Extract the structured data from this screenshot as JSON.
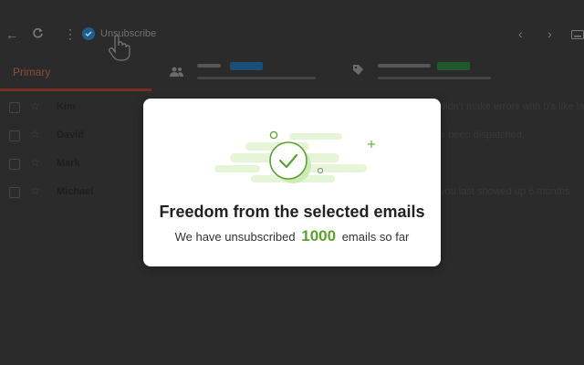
{
  "toolbar": {
    "unsubscribe_label": "Unsubscribe",
    "icons": [
      "back-arrow-icon",
      "refresh-icon",
      "more-vert-icon",
      "chevron-left-icon",
      "chevron-right-icon",
      "keyboard-icon"
    ]
  },
  "tabs": {
    "primary_label": "Primary",
    "icons": [
      "people-icon",
      "tag-icon"
    ],
    "accent_colors": [
      "#7a2d22",
      "#1a4f7a",
      "#1f5a2e"
    ]
  },
  "emails": [
    {
      "sender": "Kim",
      "snippet": "didn't make errors with 0's like la"
    },
    {
      "sender": "David",
      "snippet": "e been dispatched."
    },
    {
      "sender": "Mark",
      "snippet": ""
    },
    {
      "sender": "Michael",
      "snippet": "you last showed up 6 months"
    }
  ],
  "modal": {
    "title": "Freedom from the selected emails",
    "subtitle_before": "We have unsubscribed",
    "count": "1000",
    "subtitle_after": "emails so far",
    "accent_color": "#5aa32a",
    "icon": "check-circle-icon"
  }
}
